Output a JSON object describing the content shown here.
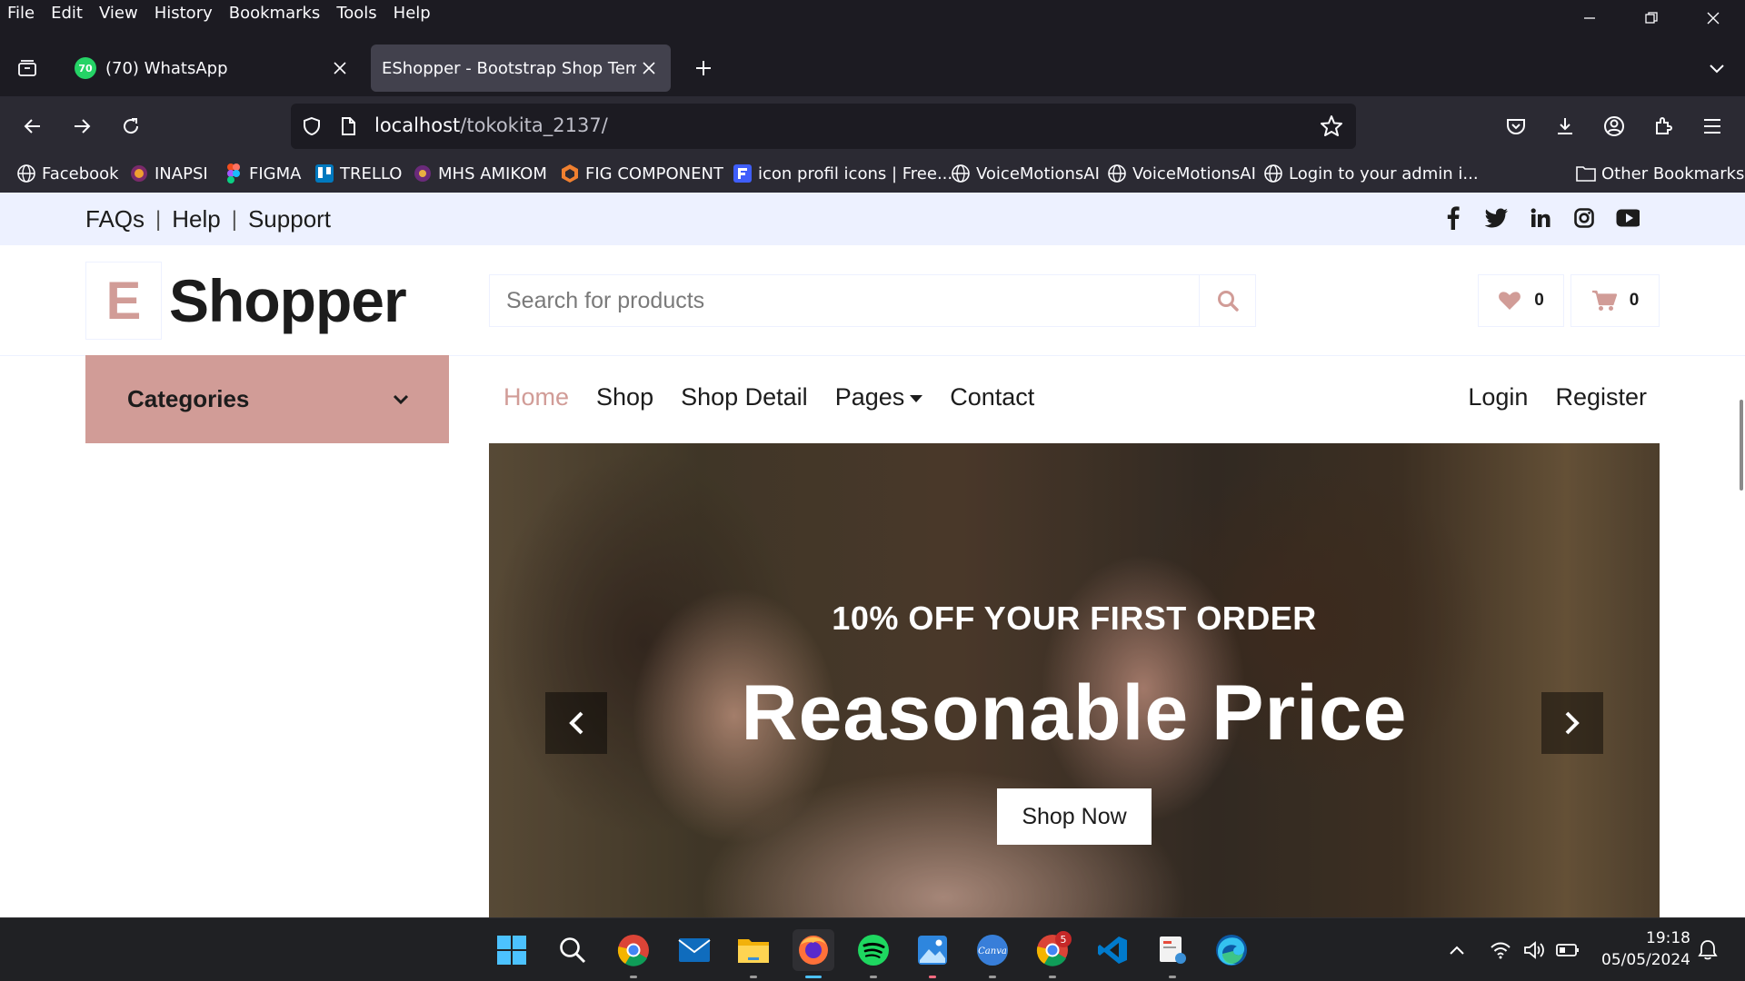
{
  "browser": {
    "menu": [
      "File",
      "Edit",
      "View",
      "History",
      "Bookmarks",
      "Tools",
      "Help"
    ],
    "tabs": [
      {
        "title": "(70) WhatsApp",
        "badge": "70",
        "active": false
      },
      {
        "title": "EShopper - Bootstrap Shop Templat",
        "active": true
      }
    ],
    "url": {
      "host": "localhost",
      "path": "/tokokita_2137/"
    },
    "bookmarks": [
      {
        "label": "Facebook",
        "icon": "globe-icon"
      },
      {
        "label": "INAPSI",
        "icon": "inapsi-icon"
      },
      {
        "label": "FIGMA",
        "icon": "figma-icon"
      },
      {
        "label": "TRELLO",
        "icon": "trello-icon"
      },
      {
        "label": "MHS AMIKOM",
        "icon": "amikom-icon"
      },
      {
        "label": "FIG COMPONENT",
        "icon": "fig-component-icon"
      },
      {
        "label": "icon profil icons | Free...",
        "icon": "flaticon-icon"
      },
      {
        "label": "VoiceMotionsAI",
        "icon": "globe-icon"
      },
      {
        "label": "VoiceMotionsAI",
        "icon": "globe-icon"
      },
      {
        "label": "Login to your admin i...",
        "icon": "globe-icon"
      }
    ],
    "other_bookmarks": "Other Bookmarks"
  },
  "topbar": {
    "links": [
      "FAQs",
      "Help",
      "Support"
    ],
    "separator": "|",
    "social": [
      "facebook-icon",
      "twitter-icon",
      "linkedin-icon",
      "instagram-icon",
      "youtube-icon"
    ]
  },
  "header": {
    "logo_letter": "E",
    "logo_text": "Shopper",
    "search_placeholder": "Search for products",
    "wishlist_count": "0",
    "cart_count": "0"
  },
  "categories": {
    "label": "Categories"
  },
  "nav": {
    "items": [
      "Home",
      "Shop",
      "Shop Detail",
      "Pages",
      "Contact"
    ],
    "active": "Home",
    "right": [
      "Login",
      "Register"
    ]
  },
  "hero": {
    "subtitle": "10% OFF YOUR FIRST ORDER",
    "title": "Reasonable Price",
    "button": "Shop Now"
  },
  "colors": {
    "primary": "#D19C97",
    "secondary": "#EDF1FF",
    "dark": "#1C1C1C"
  },
  "taskbar": {
    "apps": [
      "windows-start-icon",
      "search-icon",
      "chrome-icon",
      "mail-icon",
      "file-explorer-icon",
      "firefox-icon",
      "spotify-icon",
      "photos-icon",
      "canva-icon",
      "chrome-profile-icon",
      "vscode-icon",
      "snipping-tool-icon",
      "edge-icon"
    ],
    "chrome_badge": "5",
    "time": "19:18",
    "date": "05/05/2024"
  }
}
